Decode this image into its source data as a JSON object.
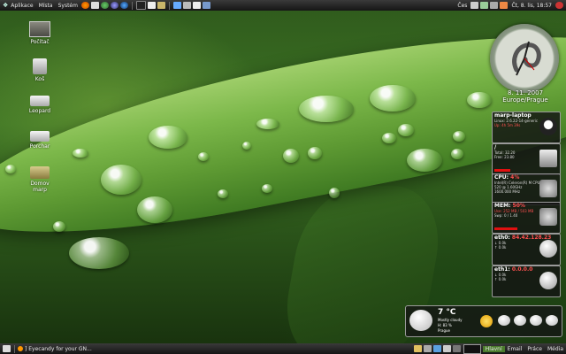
{
  "top_panel": {
    "menus": [
      "Aplikace",
      "Místa",
      "Systém"
    ],
    "right_label": "Čes",
    "clock_text": "Čt,  8. lis, 18:57"
  },
  "desktop_icons": [
    {
      "label": "Počítač",
      "icon": "computer-icon"
    },
    {
      "label": "Koš",
      "icon": "trash-icon"
    },
    {
      "label": "Leopard",
      "icon": "drive-icon"
    },
    {
      "label": "Porchar",
      "icon": "drive-icon"
    },
    {
      "label": "Domov marp",
      "icon": "home-folder-icon"
    }
  ],
  "clock_widget": {
    "date": "8. 11. 2007",
    "timezone": "Europe/Prague"
  },
  "sysmon": {
    "host": {
      "title": "marp-laptop",
      "line1": "Linux: 2.6.22-14-generic",
      "line2": "Up: 4h 5m 39s"
    },
    "disk": {
      "title": "/",
      "line1": "Total: 32.20",
      "line2": "Free: 23.80"
    },
    "cpu": {
      "title": "CPU:",
      "value": "4%",
      "line1": "Intel(R) Celeron(R) M CPU",
      "line2": "520 @ 1.60GHz",
      "line3": "1600.000 MHz"
    },
    "mem": {
      "title": "MEM:",
      "value": "50%",
      "line1": "Use: 252 MB / 503 MB",
      "line2": "Swp: 0 / 1.40"
    },
    "eth0": {
      "title": "eth0:",
      "ip": "84.42.128.23",
      "down": "0.0k",
      "up": "0.0k"
    },
    "eth1": {
      "title": "eth1:",
      "ip": "0.0.0.0",
      "down": "0.0k",
      "up": "0.0k"
    }
  },
  "weather": {
    "temp": "7 °C",
    "condition": "Mostly cloudy",
    "line2": "H: 83 %",
    "location": "Prague"
  },
  "bottom_panel": {
    "task_title": "] Eyecandy for your GN...",
    "workspaces": [
      "Hlavní",
      "Email",
      "Práce",
      "Média"
    ]
  }
}
